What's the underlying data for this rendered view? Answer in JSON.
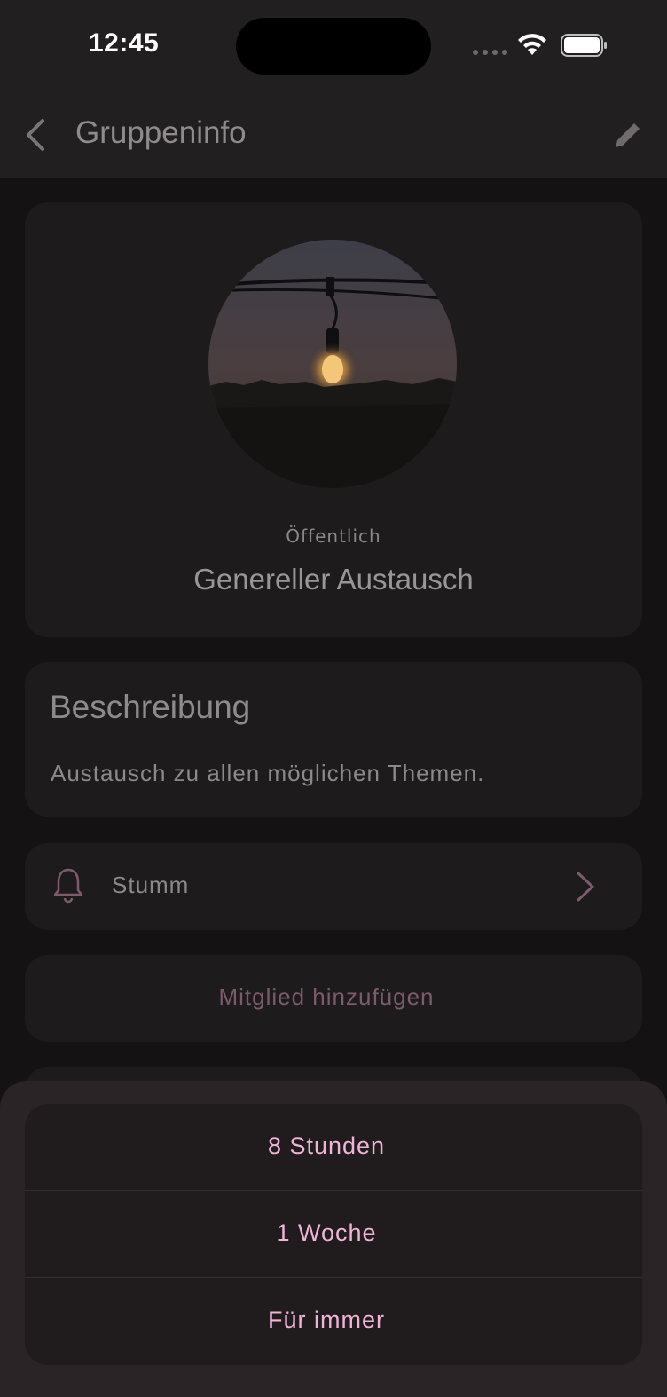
{
  "status_bar": {
    "time": "12:45"
  },
  "app_bar": {
    "title": "Gruppeninfo"
  },
  "group": {
    "visibility": "Öffentlich",
    "name": "Genereller Austausch"
  },
  "description": {
    "title": "Beschreibung",
    "text": "Austausch zu allen möglichen Themen."
  },
  "mute": {
    "label": "Stumm"
  },
  "add_member": {
    "label": "Mitglied hinzufügen"
  },
  "mute_options": [
    {
      "label": "8 Stunden"
    },
    {
      "label": "1 Woche"
    },
    {
      "label": "Für immer"
    }
  ],
  "colors": {
    "accent": "#f2b3d8",
    "muted_accent": "#7d5a6c",
    "background": "#141213",
    "card": "#1e1b1d"
  }
}
